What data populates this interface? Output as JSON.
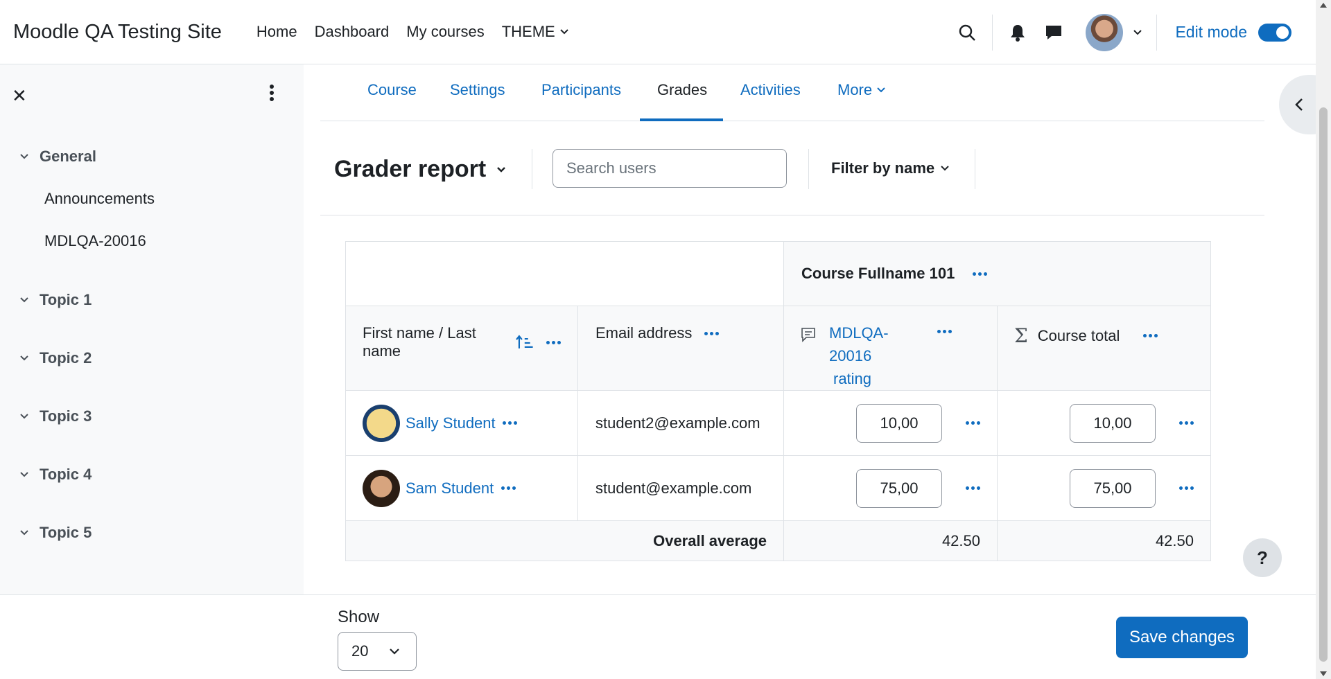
{
  "navbar": {
    "site_name": "Moodle QA Testing Site",
    "nav": [
      "Home",
      "Dashboard",
      "My courses",
      "THEME"
    ],
    "edit_mode_label": "Edit mode",
    "edit_mode_on": true
  },
  "drawer": {
    "sections": [
      {
        "name": "General",
        "activities": [
          "Announcements",
          "MDLQA-20016"
        ]
      },
      {
        "name": "Topic 1"
      },
      {
        "name": "Topic 2"
      },
      {
        "name": "Topic 3"
      },
      {
        "name": "Topic 4"
      },
      {
        "name": "Topic 5"
      }
    ]
  },
  "tabs": [
    "Course",
    "Settings",
    "Participants",
    "Grades",
    "Activities",
    "More"
  ],
  "active_tab": "Grades",
  "page": {
    "report_title": "Grader report",
    "search_placeholder": "Search users",
    "filter_label": "Filter by name"
  },
  "table": {
    "course_name": "Course Fullname 101",
    "col_name": "First name / Last name",
    "col_email": "Email address",
    "col_item_line1": "MDLQA-20016",
    "col_item_line2": "rating",
    "col_total": "Course total",
    "rows": [
      {
        "name": "Sally Student",
        "email": "student2@example.com",
        "item": "10,00",
        "total": "10,00"
      },
      {
        "name": "Sam Student",
        "email": "student@example.com",
        "item": "75,00",
        "total": "75,00"
      }
    ],
    "overall_label": "Overall average",
    "overall_item": "42.50",
    "overall_total": "42.50"
  },
  "footer": {
    "show_label": "Show",
    "per_page": "20",
    "save_label": "Save changes"
  },
  "help_label": "?",
  "colors": {
    "accent": "#0f6cbf",
    "drawer_bg": "#f8f9fa"
  }
}
